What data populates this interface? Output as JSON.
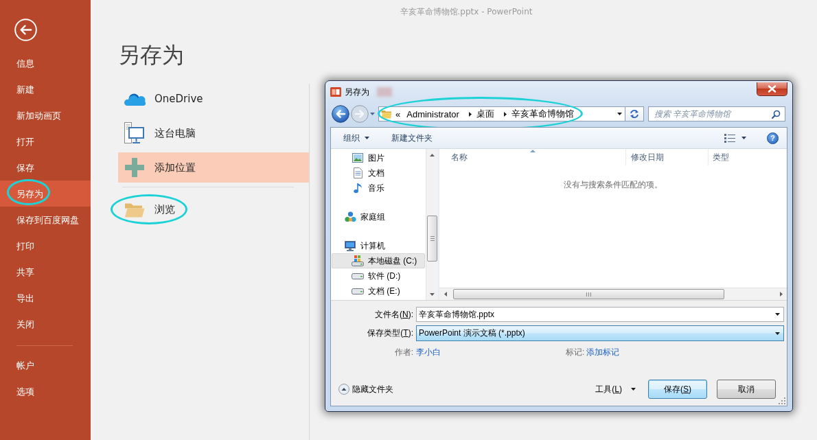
{
  "window": {
    "title": "辛亥革命博物馆.pptx - PowerPoint"
  },
  "sidebar": {
    "menu": [
      {
        "label": "信息",
        "selected": false,
        "circled": false
      },
      {
        "label": "新建",
        "selected": false,
        "circled": false
      },
      {
        "label": "新加动画页",
        "selected": false,
        "circled": false
      },
      {
        "label": "打开",
        "selected": false,
        "circled": false
      },
      {
        "label": "保存",
        "selected": false,
        "circled": false
      },
      {
        "label": "另存为",
        "selected": true,
        "circled": true
      },
      {
        "label": "保存到百度网盘",
        "selected": false,
        "circled": false
      },
      {
        "label": "打印",
        "selected": false,
        "circled": false
      },
      {
        "label": "共享",
        "selected": false,
        "circled": false
      },
      {
        "label": "导出",
        "selected": false,
        "circled": false
      },
      {
        "label": "关闭",
        "selected": false,
        "circled": false
      }
    ],
    "footer_menu": [
      {
        "label": "帐户",
        "selected": false,
        "circled": false
      },
      {
        "label": "选项",
        "selected": false,
        "circled": false
      }
    ]
  },
  "backstage": {
    "heading": "另存为",
    "locations": [
      {
        "kind": "cloud",
        "label": "OneDrive",
        "selected": false,
        "circled": false
      },
      {
        "kind": "computer",
        "label": "这台电脑",
        "selected": false,
        "circled": false
      },
      {
        "kind": "add",
        "label": "添加位置",
        "selected": true,
        "circled": false
      },
      {
        "kind": "browse",
        "label": "浏览",
        "selected": false,
        "circled": true
      }
    ]
  },
  "dialog": {
    "title": "另存为",
    "address_bar": {
      "overflow": "«",
      "crumbs": [
        "Administrator",
        "桌面",
        "辛亥革命博物馆"
      ],
      "circled": true
    },
    "search": {
      "placeholder": "搜索 辛亥革命博物馆"
    },
    "toolbar": {
      "organize": "组织",
      "new_folder": "新建文件夹",
      "help": "?"
    },
    "navigation": [
      {
        "children": [
          {
            "kind": "pictures",
            "label": "图片",
            "selected": false
          },
          {
            "kind": "documents",
            "label": "文档",
            "selected": false
          },
          {
            "kind": "music",
            "label": "音乐",
            "selected": false
          }
        ]
      },
      {
        "kind": "homegroup",
        "label": "家庭组",
        "selected": false
      },
      {
        "kind": "computer",
        "label": "计算机",
        "selected": false,
        "children": [
          {
            "kind": "system_drive",
            "label": "本地磁盘 (C:)",
            "selected": true
          },
          {
            "kind": "drive",
            "label": "软件 (D:)",
            "selected": false
          },
          {
            "kind": "drive",
            "label": "文档 (E:)",
            "selected": false
          }
        ]
      }
    ],
    "columns": [
      {
        "label": "名称",
        "sorted": true
      },
      {
        "label": "修改日期",
        "sorted": false
      },
      {
        "label": "类型",
        "sorted": false
      }
    ],
    "empty_message": "没有与搜索条件匹配的项。",
    "file_name": {
      "label": {
        "before": "文件名(",
        "key": "N",
        "after": "):"
      },
      "value": "辛亥革命博物馆.pptx"
    },
    "save_type": {
      "label": {
        "before": "保存类型(",
        "key": "T",
        "after": "):"
      },
      "value": "PowerPoint 演示文稿 (*.pptx)",
      "focused": true
    },
    "metadata": [
      {
        "label": "作者:",
        "value": "李小白"
      },
      {
        "label": "标记:",
        "value": "添加标记"
      }
    ],
    "hide_folders": "隐藏文件夹",
    "tools": {
      "before": "工具(",
      "key": "L",
      "after": ")"
    },
    "buttons": [
      {
        "label": {
          "before": "保存(",
          "key": "S",
          "after": ")"
        },
        "default": true
      },
      {
        "label": {
          "before": "取消"
        },
        "default": false
      }
    ]
  }
}
